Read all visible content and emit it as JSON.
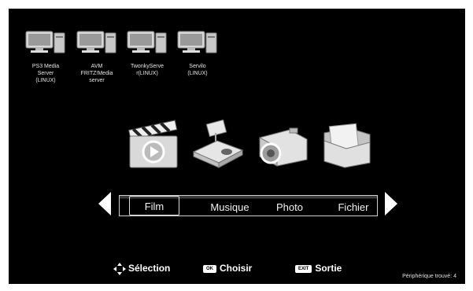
{
  "servers": [
    {
      "label": "PS3 Media\nServer\n(LINUX)"
    },
    {
      "label": "AVM\nFRITZ!Media\nserver"
    },
    {
      "label": "TwonkyServe\nr(LINUX)"
    },
    {
      "label": "Servilo\n(LINUX)"
    }
  ],
  "categories": [
    {
      "icon": "clapperboard-icon"
    },
    {
      "icon": "projector-icon"
    },
    {
      "icon": "camera-icon"
    },
    {
      "icon": "folder-icon"
    }
  ],
  "menu": {
    "items": [
      "Film",
      "Musique",
      "Photo",
      "Fichier"
    ],
    "selected": "Film"
  },
  "hints": {
    "selection": "Sélection",
    "choose_key": "OK",
    "choose": "Choisir",
    "exit_key": "EXIT",
    "exit": "Sortie"
  },
  "status": {
    "devices_found": "Périphérique trouvé: 4"
  }
}
